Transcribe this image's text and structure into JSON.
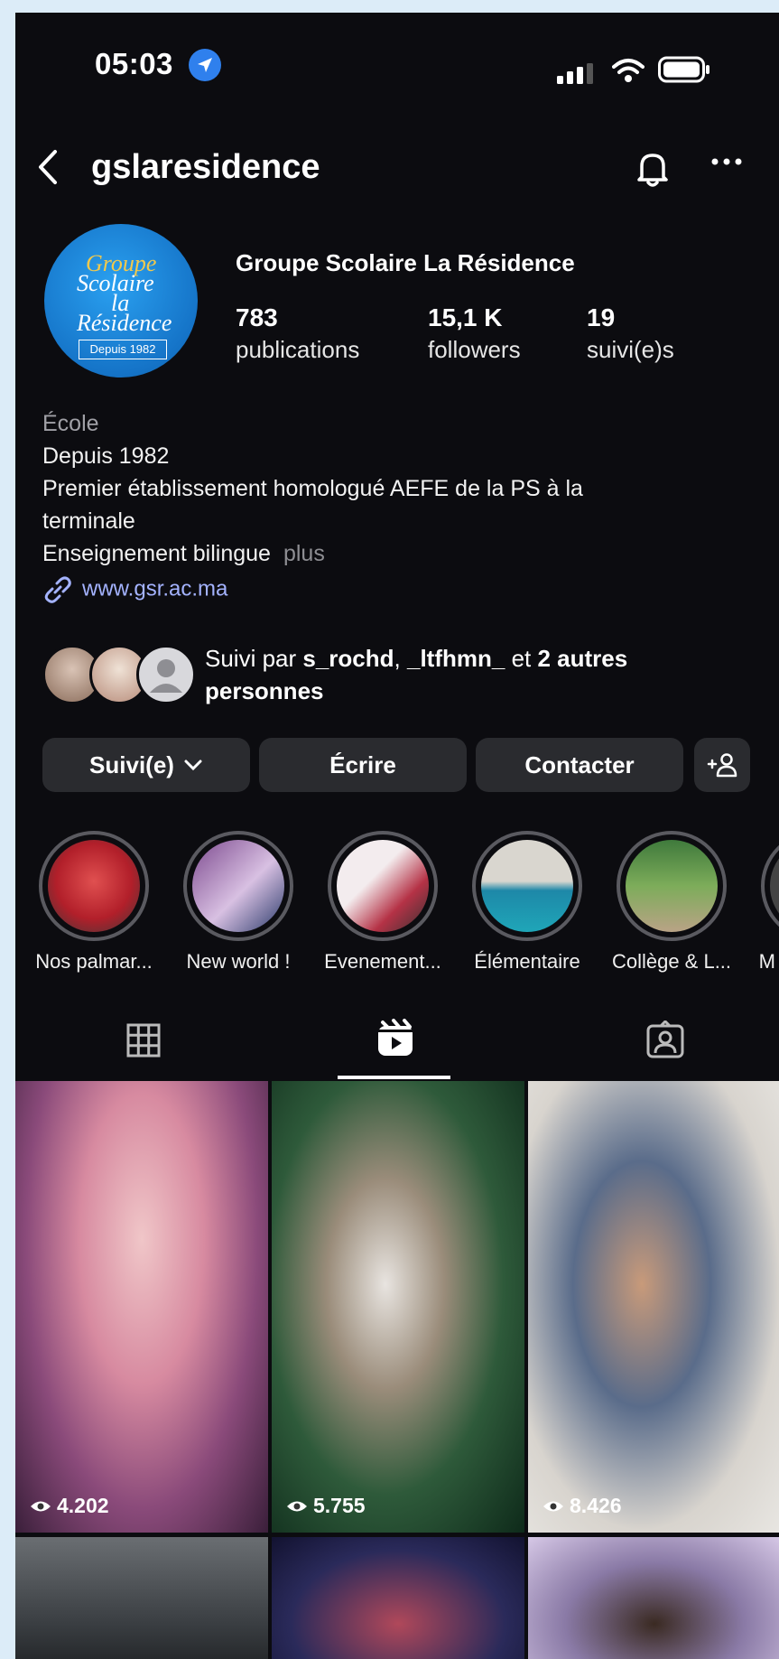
{
  "status_bar": {
    "time": "05:03"
  },
  "header": {
    "username": "gslaresidence"
  },
  "avatar": {
    "line1": "Groupe",
    "line2": "Scolaire",
    "line3": "la",
    "line4": "Résidence",
    "depuis": "Depuis 1982"
  },
  "profile": {
    "name": "Groupe Scolaire La Résidence",
    "stats": [
      {
        "value": "783",
        "label": "publications"
      },
      {
        "value": "15,1 K",
        "label": "followers"
      },
      {
        "value": "19",
        "label": "suivi(e)s"
      }
    ]
  },
  "bio": {
    "category": "École",
    "line1": "Depuis 1982",
    "line2": "Premier établissement homologué AEFE de la PS à la",
    "line3": "terminale",
    "line4": "Enseignement bilingue",
    "more": "plus",
    "link": "www.gsr.ac.ma"
  },
  "followed_by": {
    "prefix": "Suivi par ",
    "user1": "s_rochd",
    "sep": ", ",
    "user2": "_ltfhmn_",
    "and": " et ",
    "others": "2 autres",
    "others2": "personnes"
  },
  "buttons": {
    "following": "Suivi(e)",
    "message": "Écrire",
    "contact": "Contacter"
  },
  "highlights": [
    {
      "label": "Nos palmar..."
    },
    {
      "label": "New world !"
    },
    {
      "label": "Evenement..."
    },
    {
      "label": "Élémentaire"
    },
    {
      "label": "Collège & L..."
    },
    {
      "label": "M"
    }
  ],
  "reels": [
    {
      "views": "4.202"
    },
    {
      "views": "5.755"
    },
    {
      "views": "8.426"
    }
  ],
  "colors": {
    "background": "#0c0c10",
    "button": "#2a2b2f",
    "link": "#a4b3ff",
    "location_badge": "#2f80ed"
  }
}
